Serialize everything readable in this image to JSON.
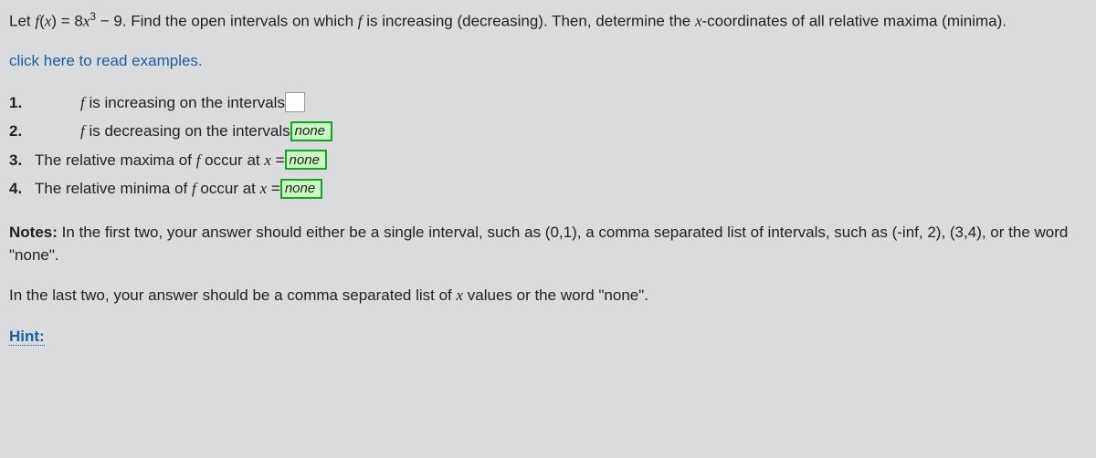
{
  "prompt": {
    "pre": "Let ",
    "func_lhs_f": "f",
    "func_lhs_open": "(",
    "func_lhs_x": "x",
    "func_lhs_close": ") = 8",
    "func_x2": "x",
    "func_exp": "3",
    "func_tail": " − 9. Find the open intervals on which ",
    "f2": "f",
    "mid": " is increasing (decreasing). Then, determine the ",
    "x2": "x",
    "tail": "-coordinates of all relative maxima (minima)."
  },
  "examples_link": "click here to read examples.",
  "items": {
    "n1": "1.",
    "l1a": "f",
    "l1b": " is increasing on the intervals",
    "v1": "",
    "n2": "2.",
    "l2a": "f",
    "l2b": " is decreasing on the intervals",
    "v2": "none",
    "n3": "3.",
    "l3a": "The relative maxima of ",
    "l3f": "f",
    "l3b": " occur at ",
    "l3x": "x",
    "l3eq": " = ",
    "v3": "none",
    "n4": "4.",
    "l4a": "The relative minima of ",
    "l4f": "f",
    "l4b": " occur at ",
    "l4x": "x",
    "l4eq": " = ",
    "v4": "none"
  },
  "notes": {
    "label": "Notes:",
    "body": " In the first two, your answer should either be a single interval, such as (0,1), a comma separated list of intervals, such as (-inf, 2), (3,4), or the word \"none\"."
  },
  "last": {
    "pre": "In the last two, your answer should be a comma separated list of ",
    "x": "x",
    "post": " values or the word \"none\"."
  },
  "hint": "Hint:"
}
